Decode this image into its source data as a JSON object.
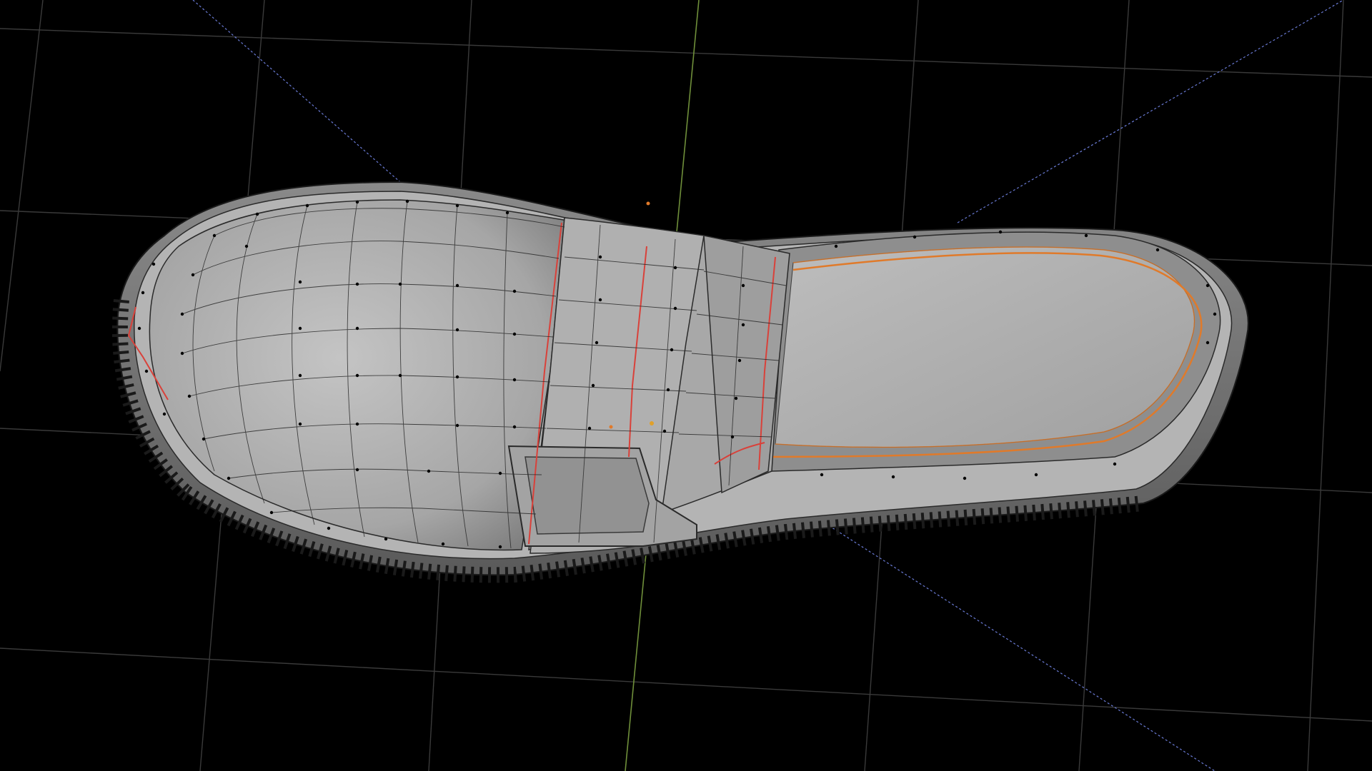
{
  "app": {
    "name": "3D viewport",
    "mode": "edit-mode"
  },
  "viewport": {
    "background": "#000000",
    "grid_color": "#3a3a3a",
    "y_axis_color": "#6f8f3a",
    "x_axis_dash_color": "#6a7bd6",
    "model_fill": "#9a9a9a",
    "model_highlight": "#c8c8c8",
    "wire_color": "#2a2a2a",
    "vertex_color": "#000000",
    "seam_color": "#d9413a",
    "selection_color": "#e07a2a"
  },
  "object": {
    "name": "shoe-loafer-mesh",
    "icon": "mesh-icon"
  }
}
